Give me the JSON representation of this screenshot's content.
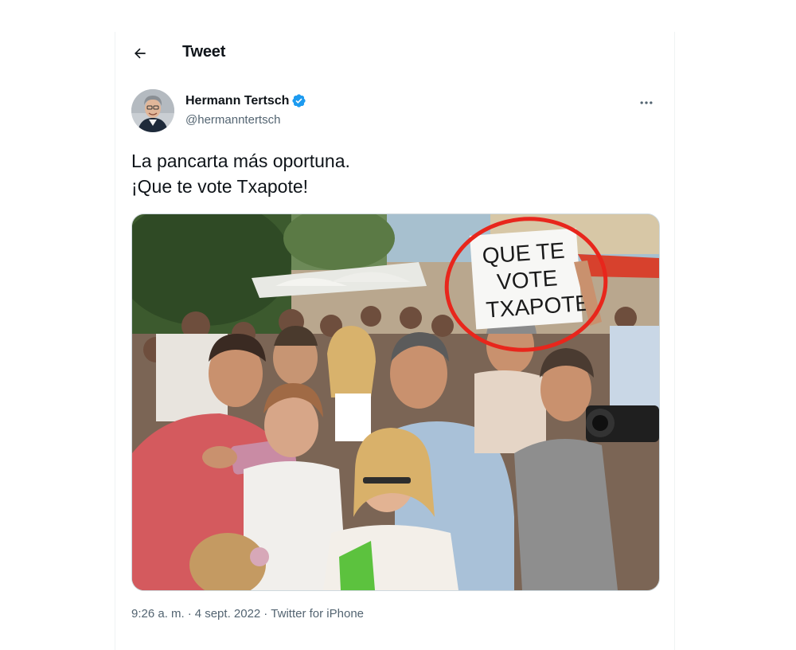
{
  "header": {
    "title": "Tweet"
  },
  "author": {
    "name": "Hermann Tertsch",
    "handle": "@hermanntertsch",
    "verified": true
  },
  "tweet": {
    "text": "La pancarta más oportuna.\n¡Que te vote Txapote!",
    "media": {
      "sign_text": "QUE TE VOTE TXAPOTE",
      "sign_lines": [
        "QUE TE",
        "VOTE",
        "TXAPOTE"
      ]
    }
  },
  "meta": {
    "time": "9:26 a. m.",
    "separator1": "·",
    "date": "4 sept. 2022",
    "separator2": "·",
    "source": "Twitter for iPhone"
  },
  "colors": {
    "text": "#0f1419",
    "secondary": "#536471",
    "verified": "#1d9bf0",
    "annotation": "#e8261c"
  },
  "icons": {
    "back": "arrow-left-icon",
    "verified": "verified-badge-icon",
    "more": "more-horizontal-icon"
  }
}
